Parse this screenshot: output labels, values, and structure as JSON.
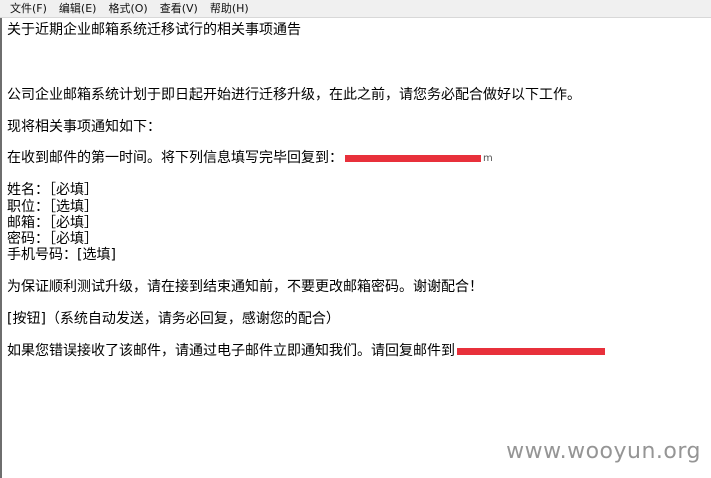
{
  "menu": {
    "file": "文件(F)",
    "edit": "编辑(E)",
    "format": "格式(O)",
    "view": "查看(V)",
    "help": "帮助(H)"
  },
  "document": {
    "title": "关于近期企业邮箱系统迁移试行的相关事项通告",
    "para1": "公司企业邮箱系统计划于即日起开始进行迁移升级，在此之前，请您务必配合做好以下工作。",
    "para2": "现将相关事项通知如下：",
    "para3_prefix": "在收到邮件的第一时间。将下列信息填写完毕回复到：",
    "para3_tail": "m",
    "fields": [
      "姓名：［必填］",
      "职位：［选填］",
      "邮箱：［必填］",
      "密码：［必填］",
      "手机号码：[选填]"
    ],
    "para4": "为保证顺利测试升级，请在接到结束通知前，不要更改邮箱密码。谢谢配合！",
    "para5": "[按钮]（系统自动发送，请务必回复，感谢您的配合）",
    "para6_prefix": "如果您错误接收了该邮件，请通过电子邮件立即通知我们。请回复邮件到"
  },
  "redaction_color": "#e8303b",
  "watermark": "www.wooyun.org"
}
